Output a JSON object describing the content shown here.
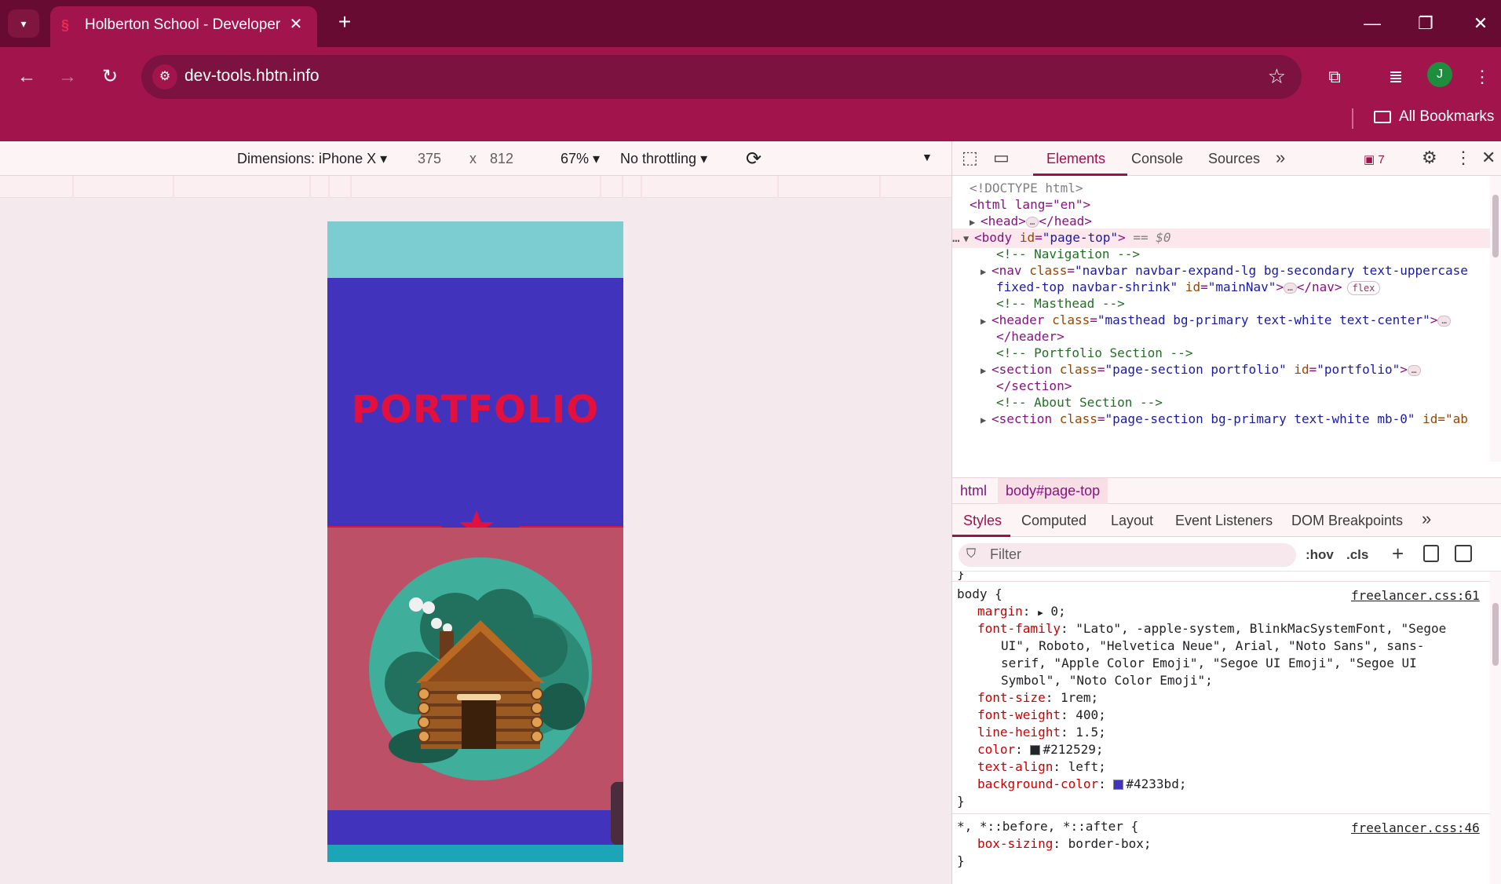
{
  "browser": {
    "tab_title": "Holberton School - Developer t",
    "url": "dev-tools.hbtn.info",
    "bookmarks_label": "All Bookmarks",
    "avatar_initial": "J"
  },
  "device_toolbar": {
    "dimensions_label": "Dimensions: iPhone X",
    "width": "375",
    "times": "x",
    "height": "812",
    "zoom": "67%",
    "throttling": "No throttling"
  },
  "device_page": {
    "hero_title": "PORTFOLIO",
    "colors": {
      "top_band": "#7bcdd1",
      "hero_bg": "#4233bd",
      "accent": "#e1103f",
      "card_bg": "#bb5066",
      "bottom_band": "#1ba5b6"
    }
  },
  "devtools": {
    "tabs": [
      "Elements",
      "Console",
      "Sources"
    ],
    "more_tabs": "»",
    "issues_count": "7",
    "dom": {
      "doctype": "<!DOCTYPE html>",
      "html_open": "<html lang=\"en\">",
      "head": "<head>",
      "head_close": "</head>",
      "body_tag": "body",
      "body_id_attr": "id",
      "body_id_val": "\"page-top\"",
      "body_eq": "== $0",
      "comment_nav": "<!-- Navigation -->",
      "nav_tag": "nav",
      "nav_class_attr": "class",
      "nav_class_val": "\"navbar navbar-expand-lg bg-secondary text-uppercase",
      "nav_class_val2": "fixed-top navbar-shrink\"",
      "nav_id_attr": "id",
      "nav_id_val": "\"mainNav\"",
      "nav_close": "</nav>",
      "flex_badge": "flex",
      "comment_masthead": "<!-- Masthead -->",
      "header_tag": "header",
      "header_class_attr": "class",
      "header_class_val": "\"masthead bg-primary text-white text-center\"",
      "header_close": "</header>",
      "comment_portfolio": "<!-- Portfolio Section -->",
      "section_tag": "section",
      "section_class_attr": "class",
      "section_class_val": "\"page-section portfolio\"",
      "section_id_attr": "id",
      "section_id_val": "\"portfolio\"",
      "section_close": "</section>",
      "comment_about": "<!-- About Section -->",
      "section2_class_val": "\"page-section bg-primary text-white mb-0\"",
      "section2_id_trunc": "id=\"ab"
    },
    "breadcrumbs": [
      "html",
      "body#page-top"
    ],
    "style_tabs": [
      "Styles",
      "Computed",
      "Layout",
      "Event Listeners",
      "DOM Breakpoints"
    ],
    "filter_placeholder": "Filter",
    "hov": ":hov",
    "cls": ".cls",
    "styles": {
      "prev_brace": "}",
      "body_selector": "body {",
      "body_source": "freelancer.css:61",
      "margin_prop": "margin",
      "margin_val": "0;",
      "ff_prop": "font-family",
      "ff_val1": "\"Lato\", -apple-system, BlinkMacSystemFont, \"Segoe",
      "ff_val2": "UI\", Roboto, \"Helvetica Neue\", Arial, \"Noto Sans\", sans-",
      "ff_val3": "serif, \"Apple Color Emoji\", \"Segoe UI Emoji\", \"Segoe UI",
      "ff_val4": "Symbol\", \"Noto Color Emoji\";",
      "fs_prop": "font-size",
      "fs_val": "1rem;",
      "fw_prop": "font-weight",
      "fw_val": "400;",
      "lh_prop": "line-height",
      "lh_val": "1.5;",
      "color_prop": "color",
      "color_val": "#212529;",
      "color_swatch": "#212529",
      "ta_prop": "text-align",
      "ta_val": "left;",
      "bg_prop": "background-color",
      "bg_val": "#4233bd;",
      "bg_swatch": "#4233bd",
      "close_brace": "}",
      "universal_selector": "*, *::before, *::after {",
      "universal_source": "freelancer.css:46",
      "bs_prop": "box-sizing",
      "bs_val": "border-box;",
      "close_brace2": "}"
    }
  },
  "icons": [
    "tab-search-icon",
    "holberton-favicon",
    "close-icon",
    "plus-icon",
    "minimize-icon",
    "restore-icon",
    "close-window-icon",
    "back-icon",
    "forward-icon",
    "reload-icon",
    "site-info-icon",
    "bookmark-star-icon",
    "extensions-icon",
    "media-icon",
    "menu-icon",
    "folder-icon",
    "rotate-icon",
    "inspect-icon",
    "device-icon",
    "issues-icon",
    "settings-icon",
    "kebab-icon",
    "filter-icon",
    "paint-icon",
    "sidebar-icon",
    "star-icon",
    "cabin-illustration"
  ]
}
